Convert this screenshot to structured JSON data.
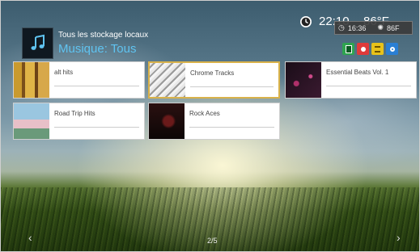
{
  "header": {
    "source_label": "Tous les stockage locaux",
    "title": "Musique: Tous",
    "icon": "music-note-icon"
  },
  "status": {
    "time": "22:10",
    "weather": "86°F",
    "popup_time": "16:36",
    "popup_weather": "86F"
  },
  "color_buttons": [
    {
      "name": "green",
      "color": "#2ea44f"
    },
    {
      "name": "red",
      "color": "#e03a3a"
    },
    {
      "name": "yellow",
      "color": "#e8c21a"
    },
    {
      "name": "blue",
      "color": "#2a7fd4"
    }
  ],
  "albums": [
    {
      "title": "alt hits",
      "selected": false
    },
    {
      "title": "Chrome Tracks",
      "selected": true
    },
    {
      "title": "Essential Beats Vol. 1",
      "selected": false
    },
    {
      "title": "Road Trip Hits",
      "selected": false
    },
    {
      "title": "Rock Aces",
      "selected": false
    }
  ],
  "pager": {
    "page": "2/5"
  }
}
